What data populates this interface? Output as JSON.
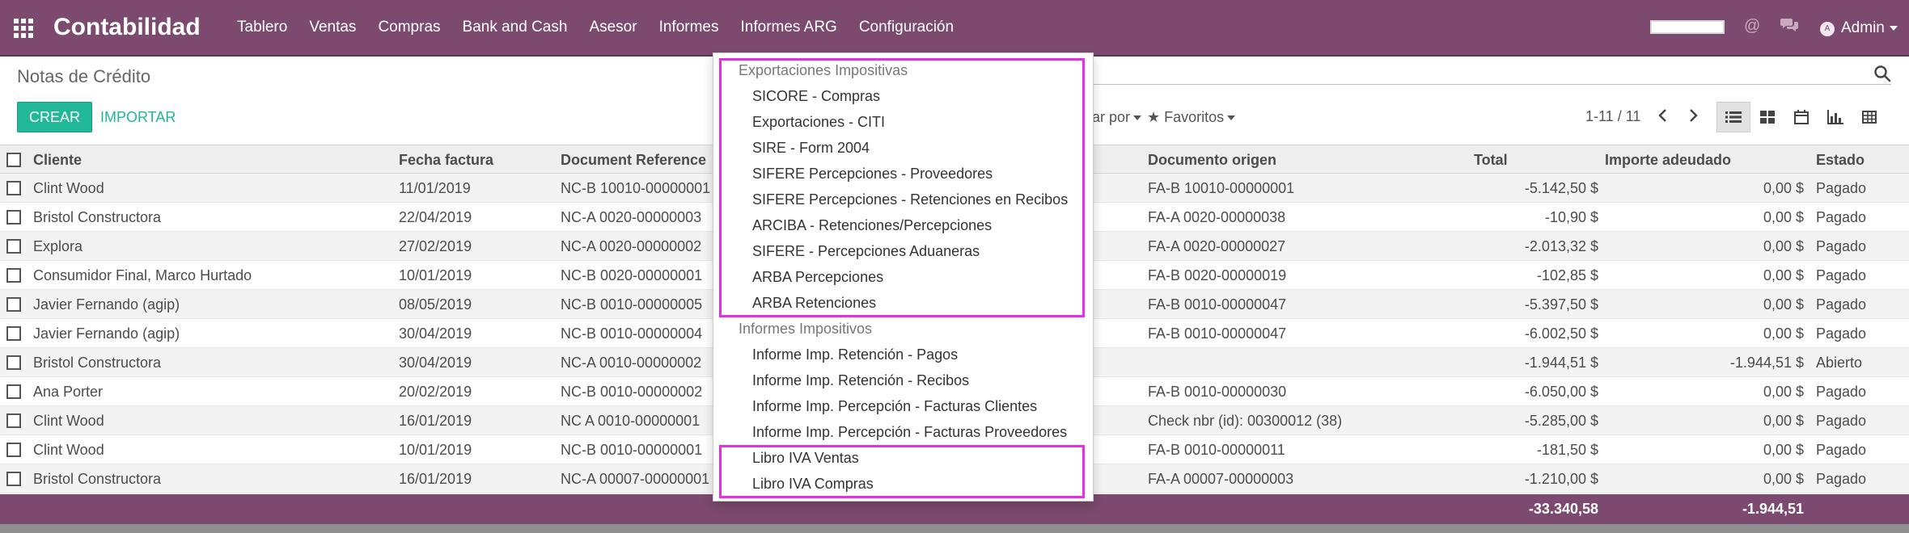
{
  "navbar": {
    "brand": "Contabilidad",
    "menu": [
      "Tablero",
      "Ventas",
      "Compras",
      "Bank and Cash",
      "Asesor",
      "Informes",
      "Informes ARG",
      "Configuración"
    ],
    "user": "Admin",
    "avatar_initial": "A",
    "progress_fraction": 1.0
  },
  "control_panel": {
    "title": "Notas de Crédito",
    "create_label": "CREAR",
    "import_label": "IMPORTAR",
    "groupby_label": "ar por",
    "favorites_label": "Favoritos",
    "pager": "1-11 / 11"
  },
  "table": {
    "headers": {
      "cliente": "Cliente",
      "fecha": "Fecha factura",
      "docref": "Document Reference",
      "origen": "Documento origen",
      "total": "Total",
      "importe": "Importe adeudado",
      "estado": "Estado"
    },
    "rows": [
      {
        "cliente": "Clint Wood",
        "fecha": "11/01/2019",
        "docref": "NC-B 10010-00000001",
        "origen": "FA-B 10010-00000001",
        "total": "-5.142,50 $",
        "importe": "0,00 $",
        "estado": "Pagado"
      },
      {
        "cliente": "Bristol Constructora",
        "fecha": "22/04/2019",
        "docref": "NC-A 0020-00000003",
        "origen": "FA-A 0020-00000038",
        "total": "-10,90 $",
        "importe": "0,00 $",
        "estado": "Pagado"
      },
      {
        "cliente": "Explora",
        "fecha": "27/02/2019",
        "docref": "NC-A 0020-00000002",
        "origen": "FA-A 0020-00000027",
        "total": "-2.013,32 $",
        "importe": "0,00 $",
        "estado": "Pagado"
      },
      {
        "cliente": "Consumidor Final, Marco Hurtado",
        "fecha": "10/01/2019",
        "docref": "NC-B 0020-00000001",
        "origen": "FA-B 0020-00000019",
        "total": "-102,85 $",
        "importe": "0,00 $",
        "estado": "Pagado"
      },
      {
        "cliente": "Javier Fernando (agip)",
        "fecha": "08/05/2019",
        "docref": "NC-B 0010-00000005",
        "origen": "FA-B 0010-00000047",
        "total": "-5.397,50 $",
        "importe": "0,00 $",
        "estado": "Pagado"
      },
      {
        "cliente": "Javier Fernando (agip)",
        "fecha": "30/04/2019",
        "docref": "NC-B 0010-00000004",
        "origen": "FA-B 0010-00000047",
        "total": "-6.002,50 $",
        "importe": "0,00 $",
        "estado": "Pagado"
      },
      {
        "cliente": "Bristol Constructora",
        "fecha": "30/04/2019",
        "docref": "NC-A 0010-00000002",
        "origen": "",
        "total": "-1.944,51 $",
        "importe": "-1.944,51 $",
        "estado": "Abierto"
      },
      {
        "cliente": "Ana Porter",
        "fecha": "20/02/2019",
        "docref": "NC-B 0010-00000002",
        "origen": "FA-B 0010-00000030",
        "total": "-6.050,00 $",
        "importe": "0,00 $",
        "estado": "Pagado"
      },
      {
        "cliente": "Clint Wood",
        "fecha": "16/01/2019",
        "docref": "NC A 0010-00000001",
        "origen": "Check nbr (id): 00300012 (38)",
        "total": "-5.285,00 $",
        "importe": "0,00 $",
        "estado": "Pagado"
      },
      {
        "cliente": "Clint Wood",
        "fecha": "10/01/2019",
        "docref": "NC-B 0010-00000001",
        "origen": "FA-B 0010-00000011",
        "total": "-181,50 $",
        "importe": "0,00 $",
        "estado": "Pagado"
      },
      {
        "cliente": "Bristol Constructora",
        "fecha": "16/01/2019",
        "docref": "NC-A 00007-00000001",
        "origen": "FA-A 00007-00000003",
        "total": "-1.210,00 $",
        "importe": "0,00 $",
        "estado": "Pagado"
      }
    ],
    "footer": {
      "total": "-33.340,58",
      "importe": "-1.944,51"
    }
  },
  "dropdown": {
    "section1_header": "Exportaciones Impositivas",
    "section1_items": [
      "SICORE - Compras",
      "Exportaciones - CITI",
      "SIRE - Form 2004",
      "SIFERE Percepciones - Proveedores",
      "SIFERE Percepciones - Retenciones en Recibos",
      "ARCIBA - Retenciones/Percepciones",
      "SIFERE - Percepciones Aduaneras",
      "ARBA Percepciones",
      "ARBA Retenciones"
    ],
    "section2_header": "Informes Impositivos",
    "section2_items": [
      "Informe Imp. Retención - Pagos",
      "Informe Imp. Retención - Recibos",
      "Informe Imp. Percepción - Facturas Clientes",
      "Informe Imp. Percepción - Facturas Proveedores",
      "Libro IVA Ventas",
      "Libro IVA Compras"
    ],
    "highlight_color": "#e62ee6"
  },
  "colors": {
    "navbar": "#7c4a6e",
    "primary_button": "#21b799"
  }
}
